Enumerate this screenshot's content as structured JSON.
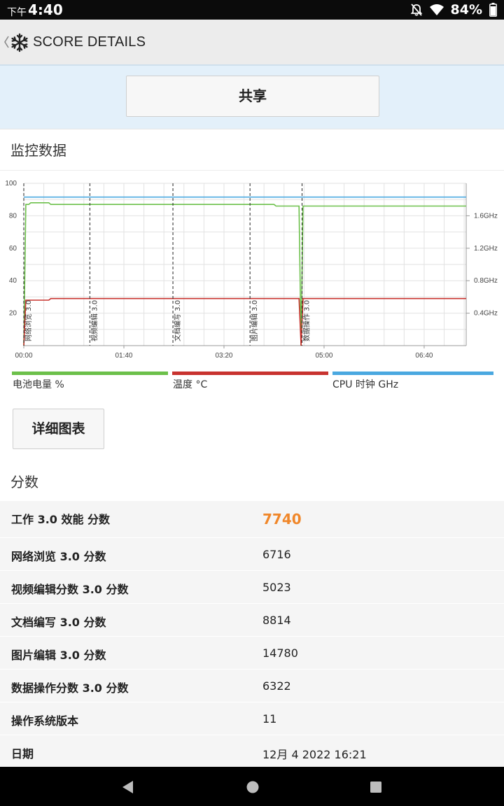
{
  "status_bar": {
    "time_prefix": "下午",
    "time": "4:40",
    "battery": "84%"
  },
  "app_bar": {
    "title": "SCORE DETAILS",
    "icons": [
      "back-chevron-icon",
      "snowflake-logo-icon"
    ]
  },
  "share_button": {
    "label": "共享"
  },
  "monitoring": {
    "title": "监控数据"
  },
  "chart_data": {
    "type": "line",
    "x_ticks": [
      "00:00",
      "01:40",
      "03:20",
      "05:00",
      "06:40"
    ],
    "y_left_ticks": [
      "100",
      "80",
      "60",
      "40",
      "20"
    ],
    "y_left_range": [
      0,
      100
    ],
    "y_right_ticks": [
      "1.6GHz",
      "1.2GHz",
      "0.8GHz",
      "0.4GHz"
    ],
    "y_right_range": [
      0,
      2.0
    ],
    "x_range_seconds": [
      0,
      442
    ],
    "markers": [
      {
        "label": "网络浏览 3.0",
        "t": 0
      },
      {
        "label": "视频编辑 3.0",
        "t": 66
      },
      {
        "label": "文档编写 3.0",
        "t": 149
      },
      {
        "label": "图片编辑 3.0",
        "t": 226
      },
      {
        "label": "数据操作 3.0",
        "t": 278
      }
    ],
    "series": [
      {
        "name": "电池电量 %",
        "axis": "left",
        "color": "#6cc04a",
        "points": [
          [
            0,
            0
          ],
          [
            2,
            87
          ],
          [
            5,
            87
          ],
          [
            7,
            88
          ],
          [
            25,
            88
          ],
          [
            27,
            87
          ],
          [
            250,
            87
          ],
          [
            252,
            86
          ],
          [
            275,
            86
          ],
          [
            277,
            0
          ],
          [
            279,
            86
          ],
          [
            442,
            86
          ]
        ]
      },
      {
        "name": "温度 °C",
        "axis": "left",
        "color": "#c8332f",
        "points": [
          [
            0,
            0
          ],
          [
            2,
            28
          ],
          [
            25,
            28
          ],
          [
            27,
            29
          ],
          [
            275,
            29
          ],
          [
            277,
            0
          ],
          [
            279,
            29
          ],
          [
            442,
            29
          ]
        ]
      },
      {
        "name": "CPU 时钟 GHz",
        "axis": "right",
        "color": "#4aa8e0",
        "points": [
          [
            0,
            1.83
          ],
          [
            442,
            1.83
          ]
        ]
      }
    ],
    "grid": true,
    "legend_position": "bottom"
  },
  "detail_chart_button": {
    "label": "详细图表"
  },
  "scores": {
    "title": "分数",
    "rows": [
      {
        "label": "工作 3.0 效能 分数",
        "value": "7740"
      },
      {
        "label": "网络浏览 3.0 分数",
        "value": "6716"
      },
      {
        "label": "视频编辑分数 3.0 分数",
        "value": "5023"
      },
      {
        "label": "文档编写 3.0 分数",
        "value": "8814"
      },
      {
        "label": "图片编辑 3.0 分数",
        "value": "14780"
      },
      {
        "label": "数据操作分数 3.0 分数",
        "value": "6322"
      },
      {
        "label": "操作系统版本",
        "value": "11"
      },
      {
        "label": "日期",
        "value": "12月 4 2022 16:21"
      }
    ]
  },
  "nav_bar": {
    "icons": [
      "back-triangle-icon",
      "home-circle-icon",
      "recents-square-icon"
    ]
  }
}
